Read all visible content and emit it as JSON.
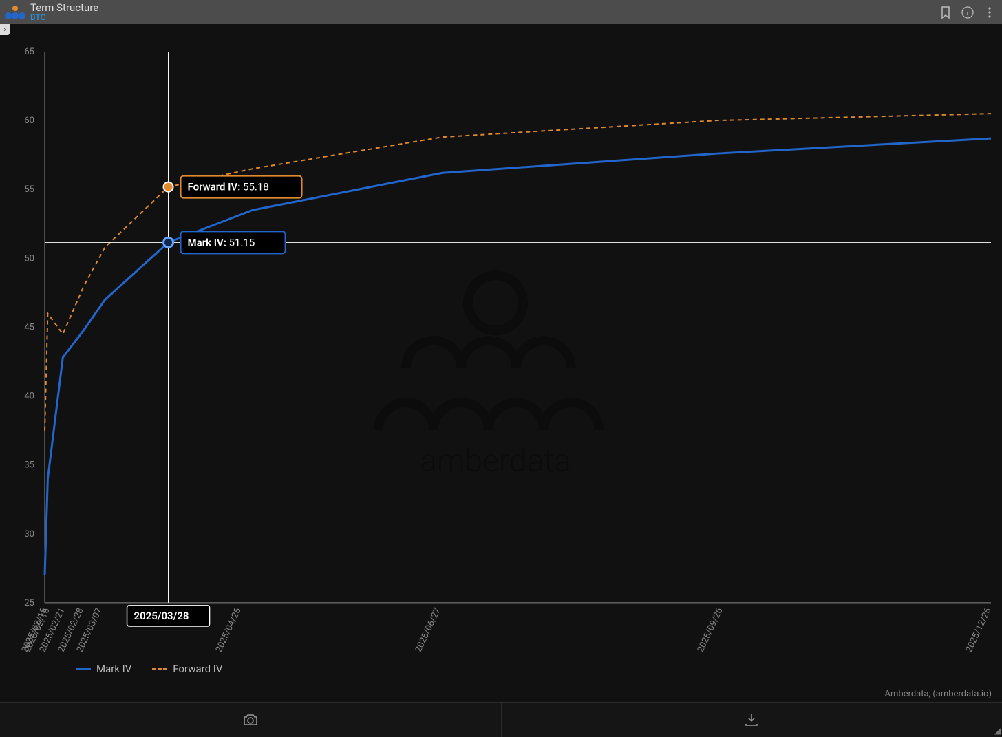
{
  "header": {
    "title": "Term Structure",
    "subtitle": "BTC"
  },
  "tooltip": {
    "date_label": "2025/03/28",
    "forward_label": "Forward IV:",
    "forward_value": "55.18",
    "mark_label": "Mark IV:",
    "mark_value": "51.15"
  },
  "legend": {
    "mark": "Mark IV",
    "forward": "Forward IV"
  },
  "credit": "Amberdata, (amberdata.io)",
  "watermark_text": "amberdata",
  "chart_data": {
    "type": "line",
    "title": "Term Structure",
    "xlabel": "",
    "ylabel": "",
    "ylim": [
      25,
      65
    ],
    "y_ticks": [
      25,
      30,
      35,
      40,
      45,
      50,
      55,
      60,
      65
    ],
    "x_categories": [
      "2025/02/15",
      "2025/02/16",
      "2025/02/21",
      "2025/02/28",
      "2025/03/07",
      "2025/03/28",
      "2025/04/25",
      "2025/06/27",
      "2025/09/26",
      "2025/12/26"
    ],
    "series": [
      {
        "name": "Mark IV",
        "style": "solid",
        "color": "#2266cc",
        "values": [
          27.0,
          34.0,
          42.8,
          44.8,
          47.0,
          51.15,
          53.5,
          56.2,
          57.6,
          58.7
        ]
      },
      {
        "name": "Forward IV",
        "style": "dashed",
        "color": "#e08a2e",
        "values": [
          37.5,
          46.0,
          44.5,
          48.0,
          50.8,
          55.18,
          56.5,
          58.8,
          60.0,
          60.5
        ]
      }
    ],
    "hover_index": 5
  }
}
